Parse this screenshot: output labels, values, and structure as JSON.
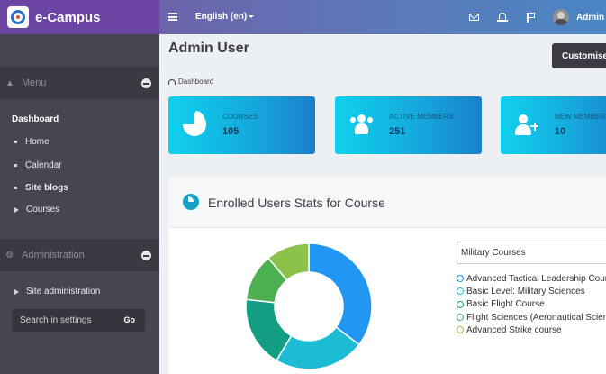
{
  "brand": {
    "name": "e-Campus"
  },
  "topbar": {
    "language": "English (en)",
    "user": "Admin"
  },
  "sidebar": {
    "menu_section": "Menu",
    "nav_title": "Dashboard",
    "items": [
      {
        "label": "Home",
        "bold": false
      },
      {
        "label": "Calendar",
        "bold": false
      },
      {
        "label": "Site blogs",
        "bold": true
      },
      {
        "label": "Courses",
        "bold": false
      }
    ],
    "admin_section": "Administration",
    "admin_item": "Site administration",
    "search_placeholder": "Search in settings",
    "search_go": "Go"
  },
  "page": {
    "title": "Admin User",
    "customise_label": "Customise",
    "breadcrumb": "Dashboard"
  },
  "stats": [
    {
      "label": "COURSES",
      "value": "105",
      "icon": "pie-chart-icon"
    },
    {
      "label": "ACTIVE MEMBERS",
      "value": "251",
      "icon": "users-icon"
    },
    {
      "label": "NEW MEMBERS",
      "value": "10",
      "icon": "user-plus-icon"
    }
  ],
  "chart": {
    "title": "Enrolled Users Stats for Course",
    "select_value": "Military Courses"
  },
  "chart_data": {
    "type": "pie",
    "categories": [
      "Advanced Tactical Leadership Course",
      "Basic Level: Military Sciences",
      "Basic Flight Course",
      "Flight Sciences (Aeronautical Science)",
      "Advanced Strike course"
    ],
    "values": [
      35,
      23,
      18,
      12,
      11
    ],
    "colors": [
      "#2196f3",
      "#1bbcd4",
      "#139e83",
      "#4caf50",
      "#8bc34a"
    ],
    "legend": "right",
    "title": "",
    "xlabel": "",
    "ylabel": ""
  }
}
